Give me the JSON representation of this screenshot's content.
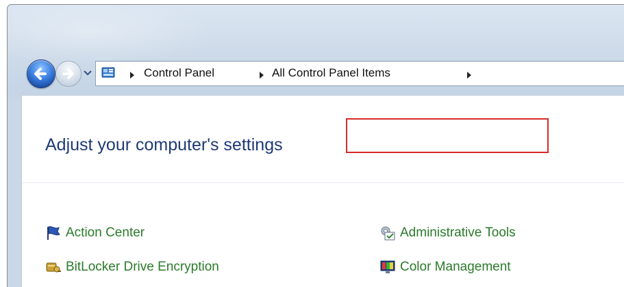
{
  "navigation": {
    "back_icon": "back-arrow-icon",
    "forward_icon": "forward-arrow-icon",
    "recent_pages_icon": "chevron-down-icon"
  },
  "address_bar": {
    "icon": "control-panel-icon",
    "breadcrumbs": [
      "Control Panel",
      "All Control Panel Items"
    ]
  },
  "main": {
    "title": "Adjust your computer's settings",
    "items": [
      {
        "label": "Action Center",
        "icon": "flag-icon"
      },
      {
        "label": "Administrative Tools",
        "icon": "admin-tools-icon"
      },
      {
        "label": "BitLocker Drive Encryption",
        "icon": "bitlocker-key-icon"
      },
      {
        "label": "Color Management",
        "icon": "color-monitor-icon"
      }
    ]
  },
  "colors": {
    "link_text": "#2a7a2a",
    "title_text": "#1e3a75",
    "highlight_border": "#d52a2a"
  }
}
